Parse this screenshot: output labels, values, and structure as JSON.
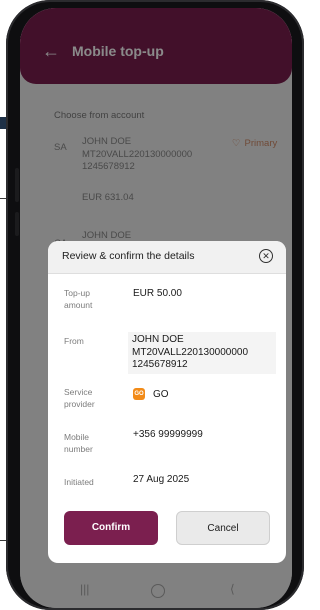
{
  "app": {
    "title": "Mobile top-up",
    "back_icon": "arrow-left-icon"
  },
  "accounts": {
    "section_title": "Choose from account",
    "items": [
      {
        "initials": "SA",
        "name": "JOHN DOE",
        "iban": "MT20VALL220130000000",
        "number": "1245678912",
        "balance": "EUR 631.04",
        "badge": "Primary"
      },
      {
        "initials": "CA",
        "name": "JOHN DOE"
      }
    ]
  },
  "modal": {
    "title": "Review & confirm the details",
    "fields": {
      "amount": {
        "label": "Top-up amount",
        "value": "EUR 50.00"
      },
      "from": {
        "label": "From",
        "name": "JOHN DOE",
        "iban": "MT20VALL220130000000",
        "number": "1245678912"
      },
      "provider": {
        "label": "Service provider",
        "icon_text": "GO",
        "value": "GO"
      },
      "mobile": {
        "label": "Mobile number",
        "value": "+356 99999999"
      },
      "initiated": {
        "label": "Initiated",
        "value": "27 Aug 2025"
      }
    },
    "buttons": {
      "confirm": "Confirm",
      "cancel": "Cancel"
    }
  },
  "colors": {
    "brand": "#7b1f4f",
    "provider_orange": "#f28b18",
    "primary_badge": "#d08a66"
  }
}
